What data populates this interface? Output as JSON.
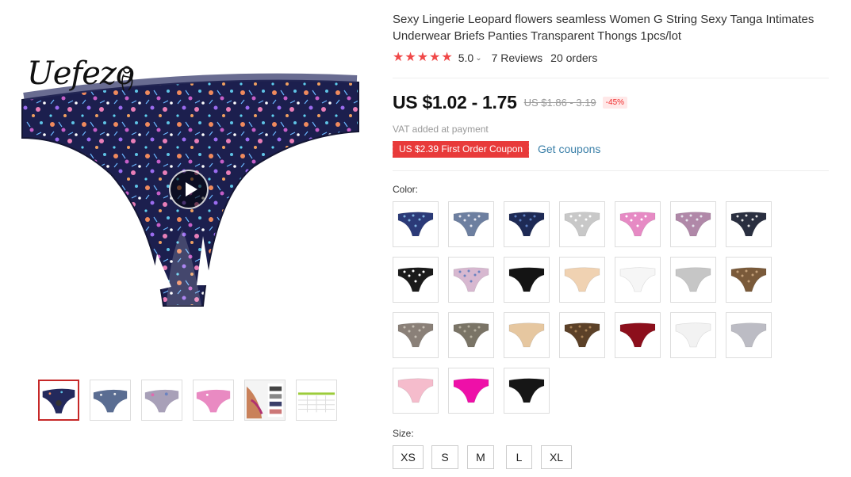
{
  "product": {
    "title": "Sexy Lingerie Leopard flowers seamless Women G String Sexy Tanga Intimates Underwear Briefs Panties Transparent Thongs 1pcs/lot",
    "brand": "Uefezo",
    "rating": "5.0",
    "stars": 5,
    "reviews": "7 Reviews",
    "orders": "20 orders"
  },
  "pricing": {
    "price": "US $1.02 - 1.75",
    "original_price": "US $1.86 - 3.19",
    "discount": "-45%",
    "vat_note": "VAT added at payment",
    "coupon": "US $2.39 First Order Coupon",
    "get_coupons": "Get coupons"
  },
  "gallery": {
    "thumbnails": [
      "navy-floral",
      "floral-gray",
      "floral-pink-gray",
      "pink-print",
      "model-photo",
      "size-chart"
    ]
  },
  "color": {
    "label": "Color:",
    "swatches": [
      {
        "name": "navy-floral",
        "fill": "#2b3a78",
        "accent": "#7fb3e0"
      },
      {
        "name": "gray-floral",
        "fill": "#6d7fa0",
        "accent": "#e8e8f0"
      },
      {
        "name": "dark-navy-floral",
        "fill": "#1e2a55",
        "accent": "#5d7fc0"
      },
      {
        "name": "light-gray-print",
        "fill": "#c8c8c8",
        "accent": "#ffffff"
      },
      {
        "name": "pink-floral",
        "fill": "#e68ac4",
        "accent": "#ffffff"
      },
      {
        "name": "pink-gray-floral",
        "fill": "#b088a8",
        "accent": "#e6e6ee"
      },
      {
        "name": "black-floral",
        "fill": "#2a2f40",
        "accent": "#e2e2e2"
      },
      {
        "name": "black-white-dots",
        "fill": "#1a1a1a",
        "accent": "#ffffff"
      },
      {
        "name": "pink-white-floral",
        "fill": "#d7b8d0",
        "accent": "#6a82c0"
      },
      {
        "name": "black",
        "fill": "#141414",
        "accent": "#141414"
      },
      {
        "name": "nude",
        "fill": "#f0d2b2",
        "accent": "#f0d2b2"
      },
      {
        "name": "white",
        "fill": "#f6f6f6",
        "accent": "#f6f6f6"
      },
      {
        "name": "light-gray",
        "fill": "#c6c6c6",
        "accent": "#c6c6c6"
      },
      {
        "name": "leopard-brown",
        "fill": "#7a5a3a",
        "accent": "#c4a07a"
      },
      {
        "name": "gray-leopard",
        "fill": "#8a8078",
        "accent": "#c8c0b6"
      },
      {
        "name": "olive-leopard",
        "fill": "#7a7466",
        "accent": "#b6b0a0"
      },
      {
        "name": "beige",
        "fill": "#e6c7a0",
        "accent": "#e6c7a0"
      },
      {
        "name": "dark-leopard",
        "fill": "#5c4128",
        "accent": "#a98358"
      },
      {
        "name": "burgundy",
        "fill": "#8c0f1c",
        "accent": "#8c0f1c"
      },
      {
        "name": "white-2",
        "fill": "#f2f2f2",
        "accent": "#f2f2f2"
      },
      {
        "name": "silver",
        "fill": "#bcbcc4",
        "accent": "#bcbcc4"
      },
      {
        "name": "light-pink",
        "fill": "#f5bccc",
        "accent": "#f5bccc"
      },
      {
        "name": "hot-pink",
        "fill": "#ee10a8",
        "accent": "#ee10a8"
      },
      {
        "name": "black-2",
        "fill": "#161616",
        "accent": "#161616"
      }
    ]
  },
  "size": {
    "label": "Size:",
    "options": [
      "XS",
      "S",
      "M",
      "L",
      "XL"
    ]
  }
}
